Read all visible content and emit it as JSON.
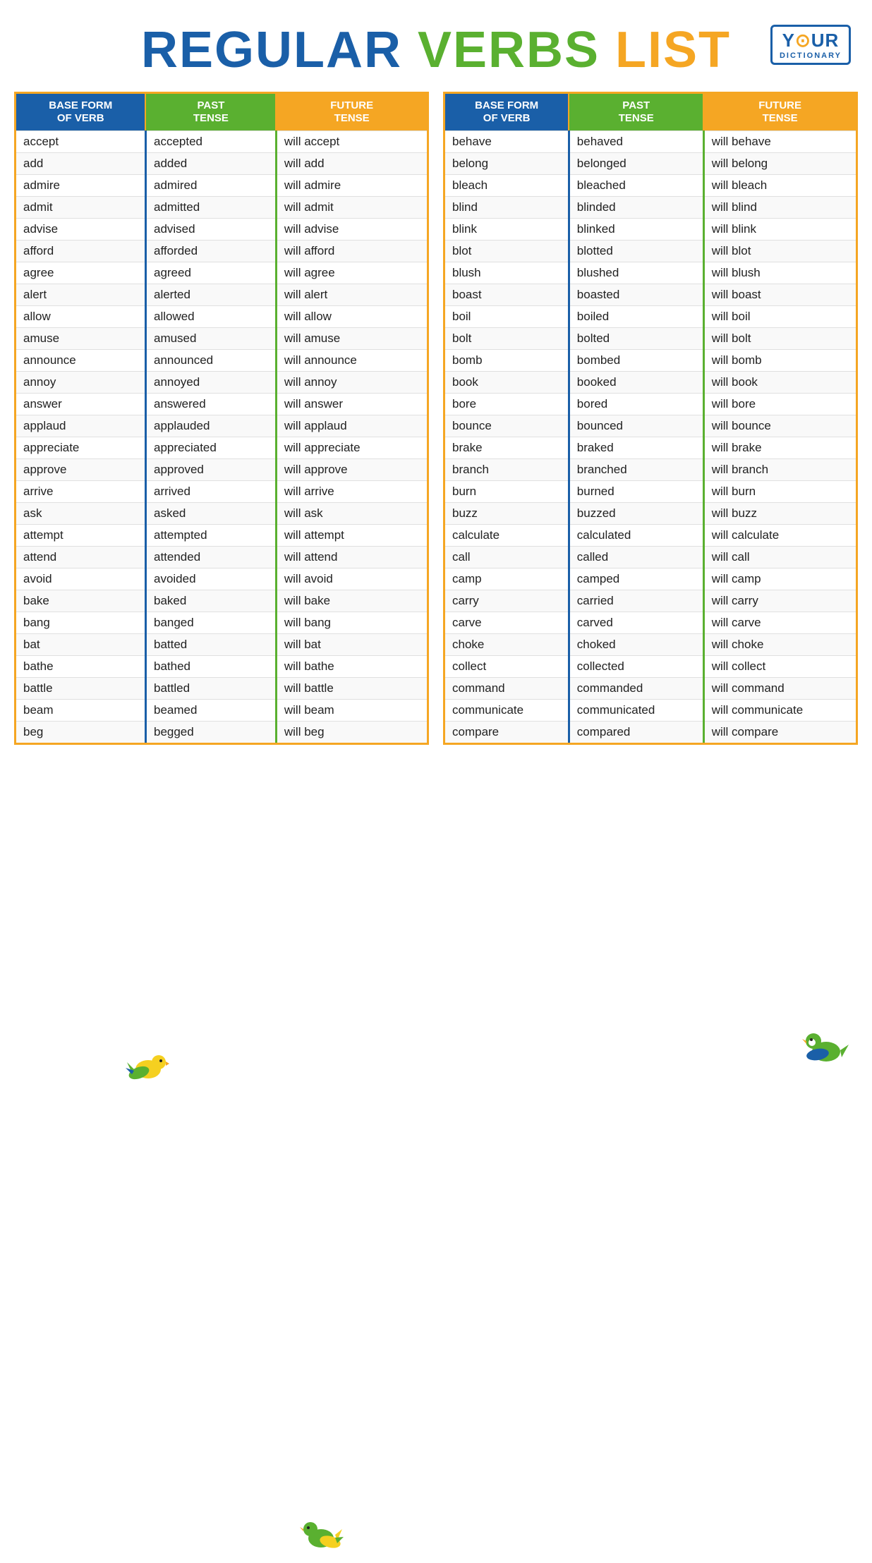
{
  "title": {
    "part1": "REGULAR",
    "part2": "VERBS",
    "part3": "LIST"
  },
  "logo": {
    "y": "Y",
    "our": "OUR",
    "dictionary": "DICTIONARY"
  },
  "headers": {
    "base_form": "BASE FORM OF VERB",
    "past_tense": "PAST TENSE",
    "future_tense": "FUTURE TENSE"
  },
  "left_verbs": [
    {
      "base": "accept",
      "past": "accepted",
      "future": "will accept"
    },
    {
      "base": "add",
      "past": "added",
      "future": "will add"
    },
    {
      "base": "admire",
      "past": "admired",
      "future": "will admire"
    },
    {
      "base": "admit",
      "past": "admitted",
      "future": "will admit"
    },
    {
      "base": "advise",
      "past": "advised",
      "future": "will advise"
    },
    {
      "base": "afford",
      "past": "afforded",
      "future": "will afford"
    },
    {
      "base": "agree",
      "past": "agreed",
      "future": "will agree"
    },
    {
      "base": "alert",
      "past": "alerted",
      "future": "will alert"
    },
    {
      "base": "allow",
      "past": "allowed",
      "future": "will allow"
    },
    {
      "base": "amuse",
      "past": "amused",
      "future": "will amuse"
    },
    {
      "base": "announce",
      "past": "announced",
      "future": "will announce"
    },
    {
      "base": "annoy",
      "past": "annoyed",
      "future": "will annoy"
    },
    {
      "base": "answer",
      "past": "answered",
      "future": "will answer"
    },
    {
      "base": "applaud",
      "past": "applauded",
      "future": "will applaud"
    },
    {
      "base": "appreciate",
      "past": "appreciated",
      "future": "will appreciate"
    },
    {
      "base": "approve",
      "past": "approved",
      "future": "will approve"
    },
    {
      "base": "arrive",
      "past": "arrived",
      "future": "will arrive"
    },
    {
      "base": "ask",
      "past": "asked",
      "future": "will ask"
    },
    {
      "base": "attempt",
      "past": "attempted",
      "future": "will attempt"
    },
    {
      "base": "attend",
      "past": "attended",
      "future": "will attend"
    },
    {
      "base": "avoid",
      "past": "avoided",
      "future": "will avoid"
    },
    {
      "base": "bake",
      "past": "baked",
      "future": "will bake"
    },
    {
      "base": "bang",
      "past": "banged",
      "future": "will bang"
    },
    {
      "base": "bat",
      "past": "batted",
      "future": "will bat"
    },
    {
      "base": "bathe",
      "past": "bathed",
      "future": "will bathe"
    },
    {
      "base": "battle",
      "past": "battled",
      "future": "will battle"
    },
    {
      "base": "beam",
      "past": "beamed",
      "future": "will beam"
    },
    {
      "base": "beg",
      "past": "begged",
      "future": "will beg"
    }
  ],
  "right_verbs": [
    {
      "base": "behave",
      "past": "behaved",
      "future": "will behave"
    },
    {
      "base": "belong",
      "past": "belonged",
      "future": "will belong"
    },
    {
      "base": "bleach",
      "past": "bleached",
      "future": "will bleach"
    },
    {
      "base": "blind",
      "past": "blinded",
      "future": "will blind"
    },
    {
      "base": "blink",
      "past": "blinked",
      "future": "will blink"
    },
    {
      "base": "blot",
      "past": "blotted",
      "future": "will blot"
    },
    {
      "base": "blush",
      "past": "blushed",
      "future": "will blush"
    },
    {
      "base": "boast",
      "past": "boasted",
      "future": "will boast"
    },
    {
      "base": "boil",
      "past": "boiled",
      "future": "will boil"
    },
    {
      "base": "bolt",
      "past": "bolted",
      "future": "will bolt"
    },
    {
      "base": "bomb",
      "past": "bombed",
      "future": "will bomb"
    },
    {
      "base": "book",
      "past": "booked",
      "future": "will book"
    },
    {
      "base": "bore",
      "past": "bored",
      "future": "will bore"
    },
    {
      "base": "bounce",
      "past": "bounced",
      "future": "will bounce"
    },
    {
      "base": "brake",
      "past": "braked",
      "future": "will brake"
    },
    {
      "base": "branch",
      "past": "branched",
      "future": "will branch"
    },
    {
      "base": "burn",
      "past": "burned",
      "future": "will burn"
    },
    {
      "base": "buzz",
      "past": "buzzed",
      "future": "will buzz"
    },
    {
      "base": "calculate",
      "past": "calculated",
      "future": "will calculate"
    },
    {
      "base": "call",
      "past": "called",
      "future": "will call"
    },
    {
      "base": "camp",
      "past": "camped",
      "future": "will camp"
    },
    {
      "base": "carry",
      "past": "carried",
      "future": "will carry"
    },
    {
      "base": "carve",
      "past": "carved",
      "future": "will carve"
    },
    {
      "base": "choke",
      "past": "choked",
      "future": "will choke"
    },
    {
      "base": "collect",
      "past": "collected",
      "future": "will collect"
    },
    {
      "base": "command",
      "past": "commanded",
      "future": "will command"
    },
    {
      "base": "communicate",
      "past": "communicated",
      "future": "will communicate"
    },
    {
      "base": "compare",
      "past": "compared",
      "future": "will compare"
    }
  ]
}
